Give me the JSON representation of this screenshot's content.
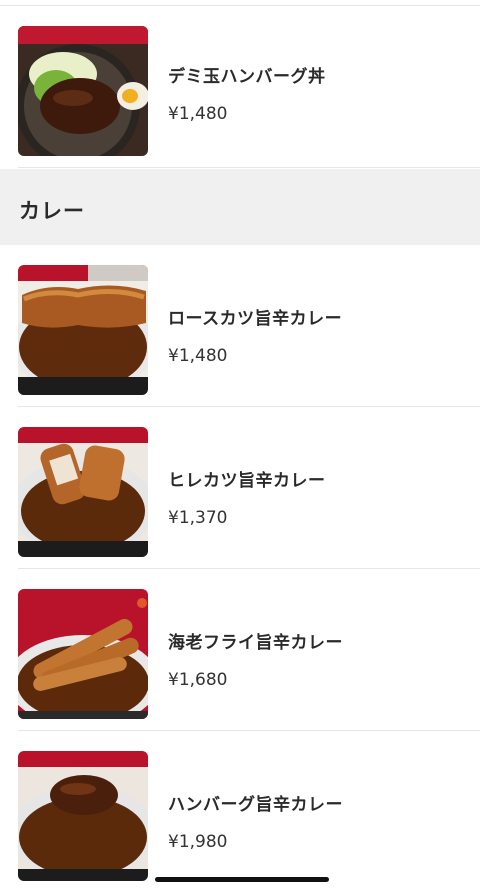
{
  "menu": {
    "items_top": [
      {
        "name": "デミ玉ハンバーグ丼",
        "price": "¥1,480",
        "icon": "hamburg-bowl-photo"
      }
    ],
    "section": {
      "title": "カレー"
    },
    "items": [
      {
        "name": "ロースカツ旨辛カレー",
        "price": "¥1,480",
        "icon": "loin-katsu-curry-photo"
      },
      {
        "name": "ヒレカツ旨辛カレー",
        "price": "¥1,370",
        "icon": "fillet-katsu-curry-photo"
      },
      {
        "name": "海老フライ旨辛カレー",
        "price": "¥1,680",
        "icon": "fried-shrimp-curry-photo"
      },
      {
        "name": "ハンバーグ旨辛カレー",
        "price": "¥1,980",
        "icon": "hamburg-curry-photo"
      }
    ]
  },
  "colors": {
    "accent_red": "#b8132a",
    "curry_brown": "#6b3510",
    "section_bg": "#f0f0f0"
  }
}
